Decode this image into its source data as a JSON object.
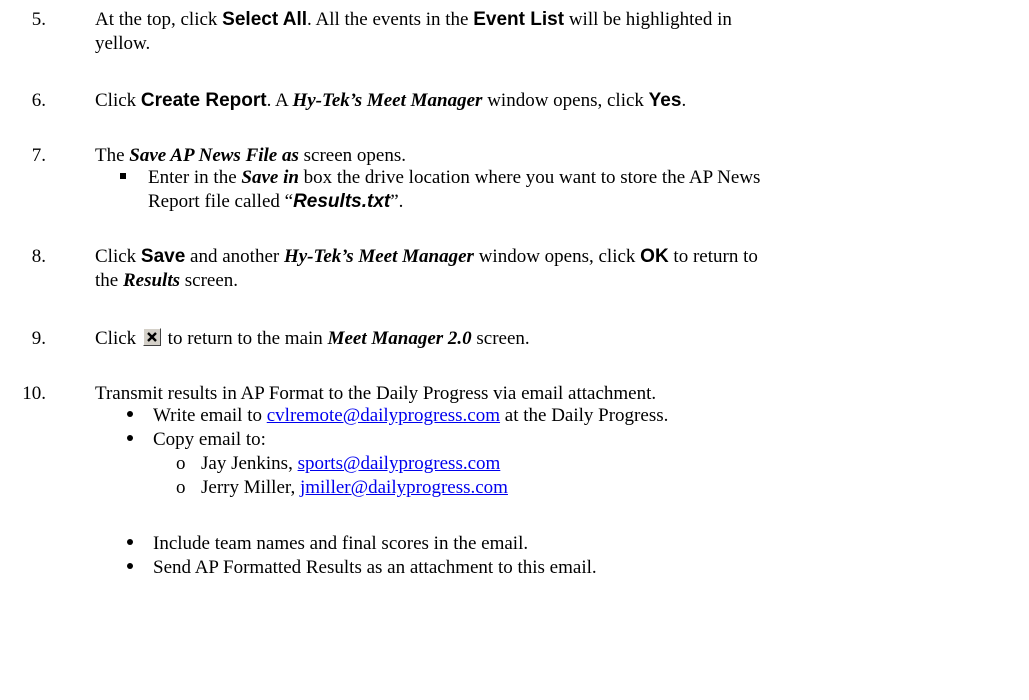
{
  "steps": [
    {
      "num": "5.",
      "parts": [
        "At the top, click ",
        "Select All",
        ".  All the events in the ",
        "Event List",
        " will be highlighted in",
        "yellow."
      ]
    },
    {
      "num": "6.",
      "parts": [
        "Click ",
        "Create Report",
        ". A ",
        "Hy-Tek’s Meet Manager",
        " window opens, click ",
        "Yes",
        "."
      ]
    },
    {
      "num": "7.",
      "parts": [
        "The ",
        "Save AP News File as",
        " screen opens."
      ],
      "bullet": [
        "Enter in the ",
        "Save in",
        " box the drive location where you want to store the AP News",
        "Report file called “",
        "Results.txt",
        "”."
      ]
    },
    {
      "num": "8.",
      "parts": [
        "Click ",
        "Save",
        " and another ",
        "Hy-Tek’s Meet Manager",
        " window opens, click ",
        "OK",
        " to return to",
        "the ",
        "Results",
        " screen."
      ]
    },
    {
      "num": "9.",
      "parts": [
        "Click ",
        " to return to the main ",
        "Meet Manager 2.0",
        " screen."
      ]
    },
    {
      "num": "10.",
      "parts": [
        "Transmit results in AP Format to the Daily Progress via email attachment."
      ],
      "bullets": {
        "write": [
          "Write email to ",
          "cvlremote@dailyprogress.com",
          " at the Daily Progress."
        ],
        "copy": "Copy email to:",
        "copy_list": [
          {
            "marker": "o",
            "name": "Jay Jenkins, ",
            "email": "sports@dailyprogress.com"
          },
          {
            "marker": "o",
            "name": "Jerry Miller, ",
            "email": "jmiller@dailyprogress.com"
          }
        ],
        "include": "Include team names and final scores in the email.",
        "send": "Send AP Formatted Results as an attachment to this email."
      }
    }
  ],
  "icons": {
    "close": "close-x-icon"
  }
}
